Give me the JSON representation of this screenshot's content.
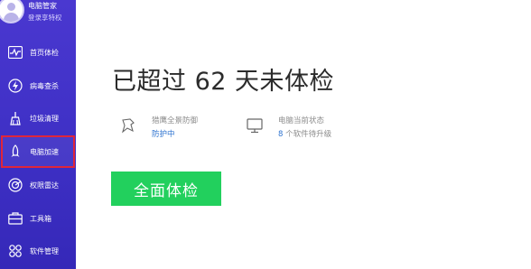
{
  "user": {
    "name": "电脑管家",
    "privilege_link": "登录享特权"
  },
  "sidebar": {
    "items": [
      {
        "label": "首页体检",
        "icon": "pulse-icon"
      },
      {
        "label": "病毒查杀",
        "icon": "lightning-icon"
      },
      {
        "label": "垃圾清理",
        "icon": "broom-icon"
      },
      {
        "label": "电脑加速",
        "icon": "rocket-icon",
        "highlighted": true
      },
      {
        "label": "权限雷达",
        "icon": "radar-icon"
      },
      {
        "label": "工具箱",
        "icon": "toolbox-icon"
      },
      {
        "label": "软件管理",
        "icon": "apps-icon"
      }
    ]
  },
  "main": {
    "headline": "已超过 62 天未体检",
    "defense": {
      "title": "猎鹰全景防御",
      "status": "防护中"
    },
    "pc_status": {
      "title": "电脑当前状态",
      "count": "8",
      "suffix": "个软件待升级"
    },
    "scan_button": "全面体检"
  },
  "colors": {
    "sidebar": "#4a38d0",
    "accent_green": "#22d05d",
    "link_blue": "#2f74d0",
    "highlight_border": "#e0263a"
  }
}
